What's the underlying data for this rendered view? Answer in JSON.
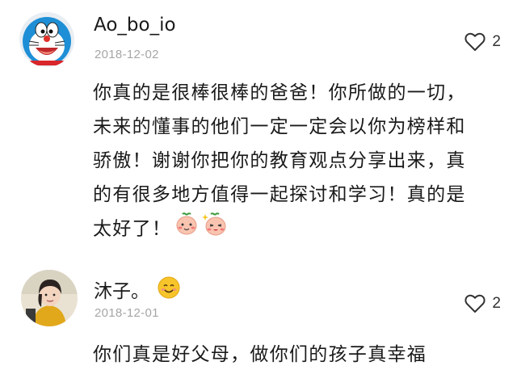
{
  "comments": [
    {
      "username": "Ao_bo_io",
      "date": "2018-12-02",
      "likes": "2",
      "avatar_icon": "doraemon-avatar",
      "lines": [
        "你真的是很棒很棒的爸爸！你所做的一切，",
        "未来的懂事的他们一定一定会以你为榜样和",
        "骄傲！谢谢你把你的教育观点分享出来，真",
        "的有很多地方值得一起探讨和学习！真的是",
        "太好了！"
      ],
      "trailing_emojis": [
        "peach-cheeky-emoji",
        "peach-sparkle-emoji"
      ]
    },
    {
      "username": "沐子。",
      "name_emoji": "smiley-face-emoji",
      "date": "2018-12-01",
      "likes": "2",
      "avatar_icon": "child-photo-avatar",
      "lines": [
        "你们真是好父母，做你们的孩子真幸福"
      ]
    }
  ],
  "colors": {
    "text": "#1a1a1a",
    "date": "#a6a6a6",
    "icon": "#333333",
    "background": "#ffffff"
  }
}
